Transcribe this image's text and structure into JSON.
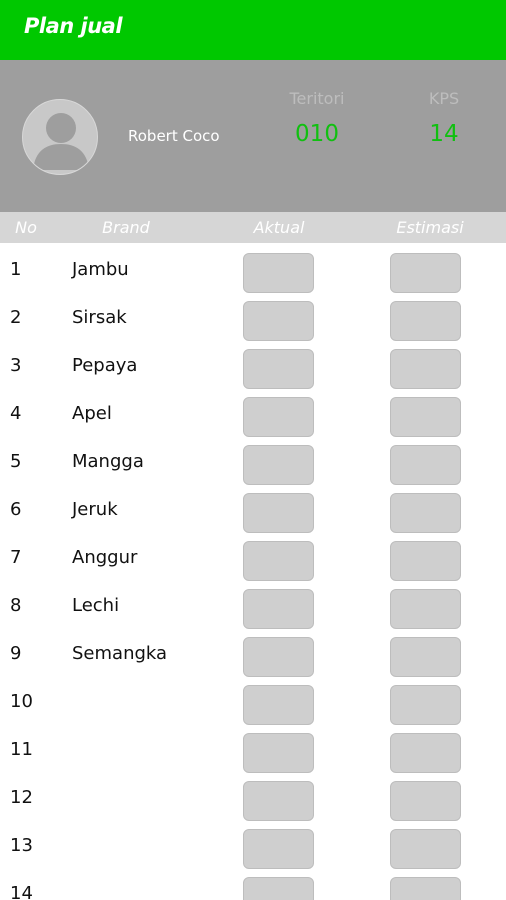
{
  "appbar": {
    "title": "Plan jual"
  },
  "profile": {
    "name": "Robert Coco",
    "teritori_label": "Teritori",
    "teritori_value": "010",
    "kps_label": "KPS",
    "kps_value": "14"
  },
  "table": {
    "headers": {
      "no": "No",
      "brand": "Brand",
      "aktual": "Aktual",
      "estimasi": "Estimasi"
    },
    "rows": [
      {
        "no": "1",
        "brand": "Jambu"
      },
      {
        "no": "2",
        "brand": "Sirsak"
      },
      {
        "no": "3",
        "brand": "Pepaya"
      },
      {
        "no": "4",
        "brand": "Apel"
      },
      {
        "no": "5",
        "brand": "Mangga"
      },
      {
        "no": "6",
        "brand": "Jeruk"
      },
      {
        "no": "7",
        "brand": "Anggur"
      },
      {
        "no": "8",
        "brand": "Lechi"
      },
      {
        "no": "9",
        "brand": "Semangka"
      },
      {
        "no": "10",
        "brand": ""
      },
      {
        "no": "11",
        "brand": ""
      },
      {
        "no": "12",
        "brand": ""
      },
      {
        "no": "13",
        "brand": ""
      },
      {
        "no": "14",
        "brand": ""
      }
    ]
  },
  "colors": {
    "appbar": "#00c800",
    "profile_bg": "#9e9e9e",
    "stat_value": "#10c010",
    "header_bg": "#d6d6d6",
    "input_bg": "#cfcfcf"
  }
}
